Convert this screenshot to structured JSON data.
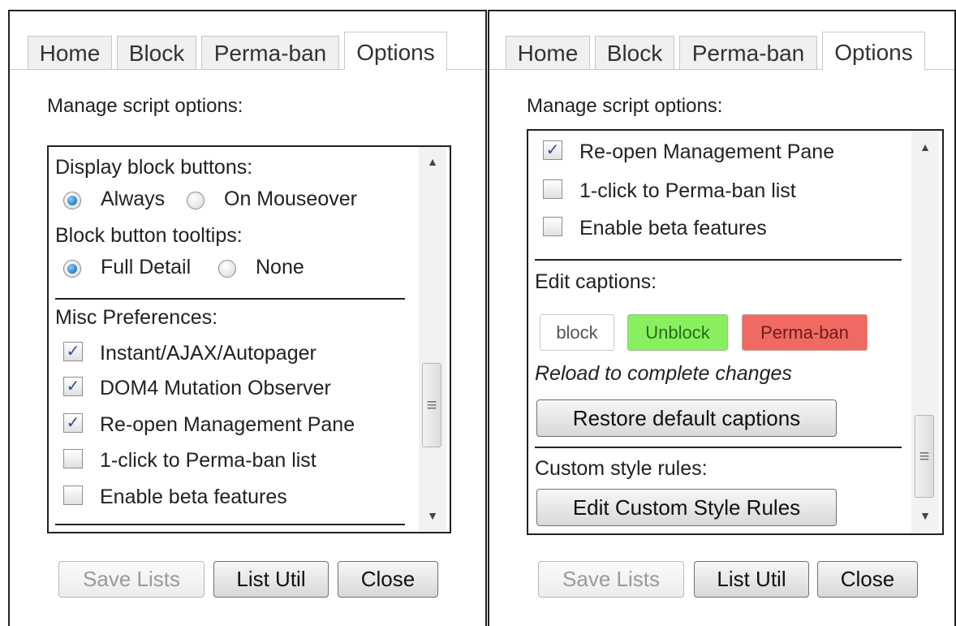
{
  "tabs": [
    "Home",
    "Block",
    "Perma-ban",
    "Options"
  ],
  "active_tab": "Options",
  "manage_heading": "Manage script options:",
  "left": {
    "display_block_buttons": {
      "label": "Display block buttons:",
      "options": [
        "Always",
        "On Mouseover"
      ],
      "selected": "Always"
    },
    "block_button_tooltips": {
      "label": "Block button tooltips:",
      "options": [
        "Full Detail",
        "None"
      ],
      "selected": "Full Detail"
    },
    "misc_label": "Misc Preferences:",
    "misc_items": [
      {
        "label": "Instant/AJAX/Autopager",
        "checked": true
      },
      {
        "label": "DOM4 Mutation Observer",
        "checked": true
      },
      {
        "label": "Re-open Management Pane",
        "checked": true
      },
      {
        "label": "1-click to Perma-ban list",
        "checked": false
      },
      {
        "label": "Enable beta features",
        "checked": false
      }
    ]
  },
  "right": {
    "misc_items": [
      {
        "label": "Re-open Management Pane",
        "checked": true
      },
      {
        "label": "1-click to Perma-ban list",
        "checked": false
      },
      {
        "label": "Enable beta features",
        "checked": false
      }
    ],
    "edit_captions_label": "Edit captions:",
    "captions": {
      "block": {
        "text": "block",
        "bg": "#ffffff",
        "color": "#555555"
      },
      "unblock": {
        "text": "Unblock",
        "bg": "#88f05e",
        "color": "#2a6a17"
      },
      "perma": {
        "text": "Perma-ban",
        "bg": "#f06a63",
        "color": "#6b1c17"
      }
    },
    "reload_note": "Reload to complete changes",
    "restore_button": "Restore default captions",
    "custom_style_label": "Custom style rules:",
    "edit_custom_button": "Edit Custom Style Rules"
  },
  "footer": {
    "save_lists": "Save Lists",
    "list_util": "List Util",
    "close": "Close"
  },
  "check_glyph": "✓",
  "icons": {
    "scroll_up": "▲",
    "scroll_down": "▼",
    "grip": "≡"
  }
}
